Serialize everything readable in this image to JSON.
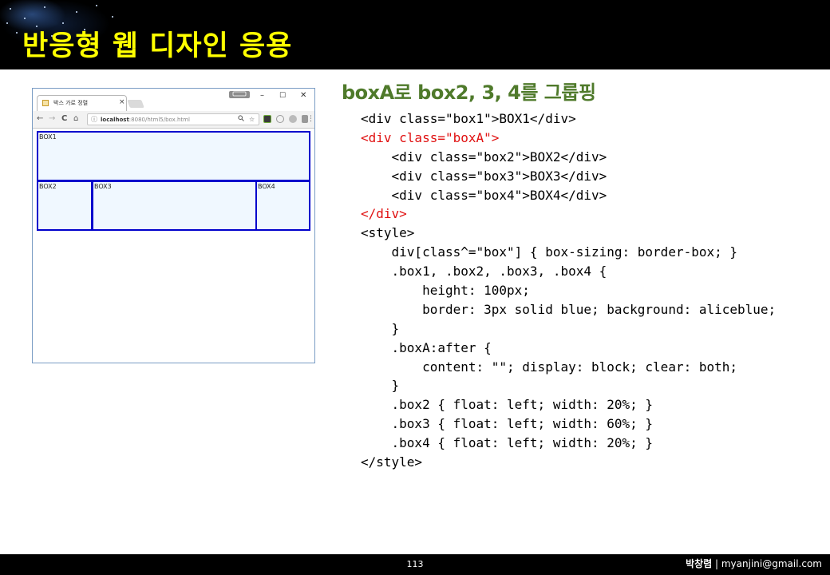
{
  "header": {
    "title": "반응형 웹 디자인 응용"
  },
  "browser": {
    "tab_title": "박스 가로 정렬",
    "tab_close": "×",
    "profile_badge": "",
    "window_controls": {
      "minimize": "–",
      "maximize": "☐",
      "close": "✕"
    },
    "nav": {
      "back": "←",
      "forward": "→",
      "reload": "C",
      "home": "⌂"
    },
    "address_bar": {
      "host": "localhost",
      "path": ":8080/html5/box.html",
      "info_icon": "info-icon",
      "zoom_icon": "🔍",
      "star_icon": "☆"
    },
    "extensions": [
      "evernote-icon",
      "clock-icon",
      "shield-icon",
      "translate-icon",
      "puzzle-icon"
    ],
    "menu_icon": "⋮",
    "boxes": {
      "box1": "BOX1",
      "box2": "BOX2",
      "box3": "BOX3",
      "box4": "BOX4"
    },
    "box_colors": {
      "border": "#0000cc",
      "background": "#f0f8ff"
    }
  },
  "slide": {
    "title": "boxA로 box2, 3, 4를 그룹핑"
  },
  "code": {
    "lines": [
      {
        "text": "<div class=\"box1\">BOX1</div>",
        "highlight": false
      },
      {
        "text": "<div class=\"boxA\">",
        "highlight": true
      },
      {
        "text": "    <div class=\"box2\">BOX2</div>",
        "highlight": false
      },
      {
        "text": "    <div class=\"box3\">BOX3</div>",
        "highlight": false
      },
      {
        "text": "    <div class=\"box4\">BOX4</div>",
        "highlight": false
      },
      {
        "text": "</div>",
        "highlight": true
      },
      {
        "text": "<style>",
        "highlight": false
      },
      {
        "text": "    div[class^=\"box\"] { box-sizing: border-box; }",
        "highlight": false
      },
      {
        "text": "    .box1, .box2, .box3, .box4 {",
        "highlight": false
      },
      {
        "text": "        height: 100px;",
        "highlight": false
      },
      {
        "text": "        border: 3px solid blue; background: aliceblue;",
        "highlight": false
      },
      {
        "text": "    }",
        "highlight": false
      },
      {
        "text": "    .boxA:after {",
        "highlight": false
      },
      {
        "text": "        content: \"\"; display: block; clear: both;",
        "highlight": false
      },
      {
        "text": "    }",
        "highlight": false
      },
      {
        "text": "    .box2 { float: left; width: 20%; }",
        "highlight": false
      },
      {
        "text": "    .box3 { float: left; width: 60%; }",
        "highlight": false
      },
      {
        "text": "    .box4 { float: left; width: 20%; }",
        "highlight": false
      },
      {
        "text": "</style>",
        "highlight": false
      }
    ],
    "highlight_color": "#e01010"
  },
  "footer": {
    "page_number": "113",
    "author_name": "박창렴",
    "separator": " | ",
    "author_email": "myanjini@gmail.com"
  },
  "colors": {
    "header_title": "#ffff00",
    "slide_title": "#4f7a2b",
    "bar_background": "#000000"
  }
}
